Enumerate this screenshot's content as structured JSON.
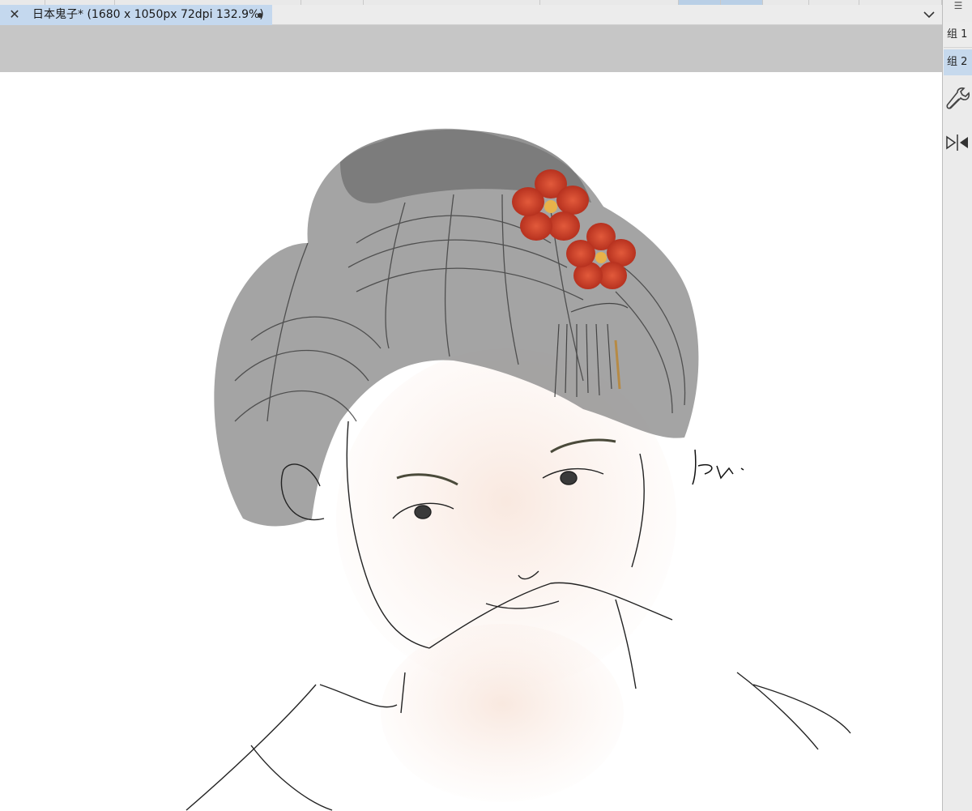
{
  "document_tab": {
    "close_symbol": "✕",
    "title": "日本鬼子* (1680 x 1050px 72dpi 132.9%)"
  },
  "side_panel": {
    "menu_symbol": "☰",
    "groups": [
      {
        "label": "组 1",
        "active": false
      },
      {
        "label": "组 2",
        "active": true
      }
    ],
    "tools": [
      {
        "icon": "wrench-icon"
      },
      {
        "icon": "flip-horizontal-icon"
      }
    ]
  },
  "canvas": {
    "background": "#ffffff",
    "artwork": "sketch of a woman with flower hairpin"
  },
  "colors": {
    "accent_tab": "#c4d8ee",
    "toolbar_gray": "#c6c6c6",
    "flower_red": "#c23a26",
    "hair_gray": "#7b7b7b"
  }
}
